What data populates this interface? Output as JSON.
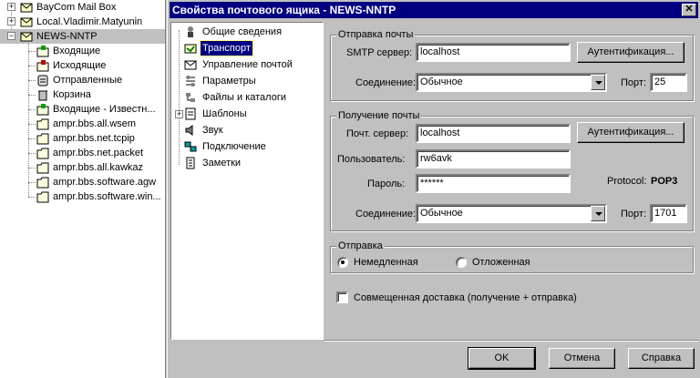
{
  "tree": {
    "items": [
      {
        "label": "BayCom Mail Box",
        "icon": "mailbox-icon"
      },
      {
        "label": "Local.Vladimir.Matyunin",
        "icon": "mailbox-icon"
      },
      {
        "label": "NEWS-NNTP",
        "icon": "mailbox-icon"
      },
      {
        "label": "Входящие",
        "icon": "inbox-folder-icon"
      },
      {
        "label": "Исходящие",
        "icon": "outbox-folder-icon"
      },
      {
        "label": "Отправленные",
        "icon": "sent-folder-icon"
      },
      {
        "label": "Корзина",
        "icon": "trash-icon"
      },
      {
        "label": "Входящие - Известн...",
        "icon": "inbox-folder-icon"
      },
      {
        "label": "ampr.bbs.all.wsem",
        "icon": "newsgroup-folder-icon"
      },
      {
        "label": "ampr.bbs.net.tcpip",
        "icon": "newsgroup-folder-icon"
      },
      {
        "label": "ampr.bbs.net.packet",
        "icon": "newsgroup-folder-icon"
      },
      {
        "label": "ampr.bbs.all.kawkaz",
        "icon": "newsgroup-folder-icon"
      },
      {
        "label": "ampr.bbs.software.agw",
        "icon": "newsgroup-folder-icon"
      },
      {
        "label": "ampr.bbs.software.win...",
        "icon": "newsgroup-folder-icon"
      }
    ]
  },
  "dialog": {
    "title": "Свойства почтового ящика - NEWS-NNTP",
    "close_glyph": "✕",
    "nav": [
      {
        "label": "Общие сведения",
        "icon": "info-icon"
      },
      {
        "label": "Транспорт",
        "icon": "transport-icon"
      },
      {
        "label": "Управление почтой",
        "icon": "mail-management-icon"
      },
      {
        "label": "Параметры",
        "icon": "parameters-icon"
      },
      {
        "label": "Файлы и каталоги",
        "icon": "files-icon"
      },
      {
        "label": "Шаблоны",
        "icon": "templates-icon"
      },
      {
        "label": "Звук",
        "icon": "sound-icon"
      },
      {
        "label": "Подключение",
        "icon": "connection-icon"
      },
      {
        "label": "Заметки",
        "icon": "notes-icon"
      }
    ],
    "expand_glyph": "+",
    "send_group": {
      "title": "Отправка почты",
      "smtp_label": "SMTP сервер:",
      "smtp_value": "localhost",
      "auth_button": "Аутентификация...",
      "connection_label": "Соединение:",
      "connection_value": "Обычное",
      "port_label": "Порт:",
      "port_value": "25"
    },
    "receive_group": {
      "title": "Получение почты",
      "server_label": "Почт. сервер:",
      "server_value": "localhost",
      "auth_button": "Аутентификация...",
      "user_label": "Пользователь:",
      "user_value": "rw6avk",
      "password_label": "Пароль:",
      "password_value": "******",
      "protocol_label": "Protocol:",
      "protocol_value": "POP3",
      "connection_label": "Соединение:",
      "connection_value": "Обычное",
      "port_label": "Порт:",
      "port_value": "1701"
    },
    "dispatch_group": {
      "title": "Отправка",
      "immediate": "Немедленная",
      "deferred": "Отложенная"
    },
    "combined_delivery": "Совмещенная доставка (получение + отправка)",
    "buttons": {
      "ok": "OK",
      "cancel": "Отмена",
      "help": "Справка"
    }
  },
  "colors": {
    "titlebar": "#000080",
    "face": "#c0c0c0",
    "selection": "#000080"
  }
}
